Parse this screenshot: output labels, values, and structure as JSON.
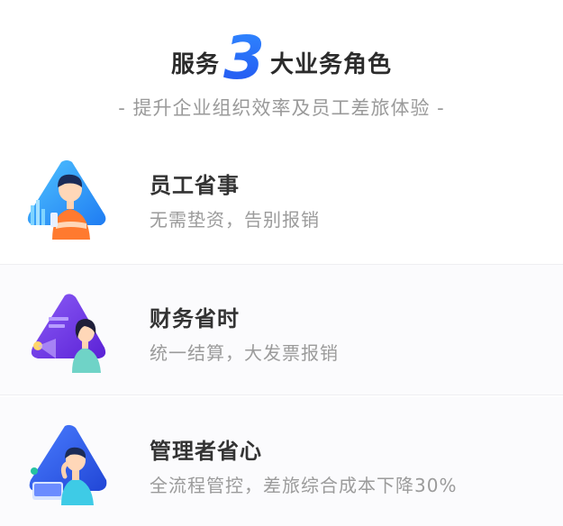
{
  "header": {
    "title_prefix": "服务",
    "title_number": "3",
    "title_suffix": "大业务角色",
    "subtitle": "- 提升企业组织效率及员工差旅体验 -"
  },
  "roles": [
    {
      "title": "员工省事",
      "desc": "无需垫资，告别报销",
      "icon": "employee-avatar-icon"
    },
    {
      "title": "财务省时",
      "desc": "统一结算，大发票报销",
      "icon": "finance-avatar-icon"
    },
    {
      "title": "管理者省心",
      "desc": "全流程管控，差旅综合成本下降30%",
      "icon": "manager-avatar-icon"
    }
  ],
  "colors": {
    "accent": "#2356f0",
    "title": "#333333",
    "muted": "#9b9b9b"
  }
}
